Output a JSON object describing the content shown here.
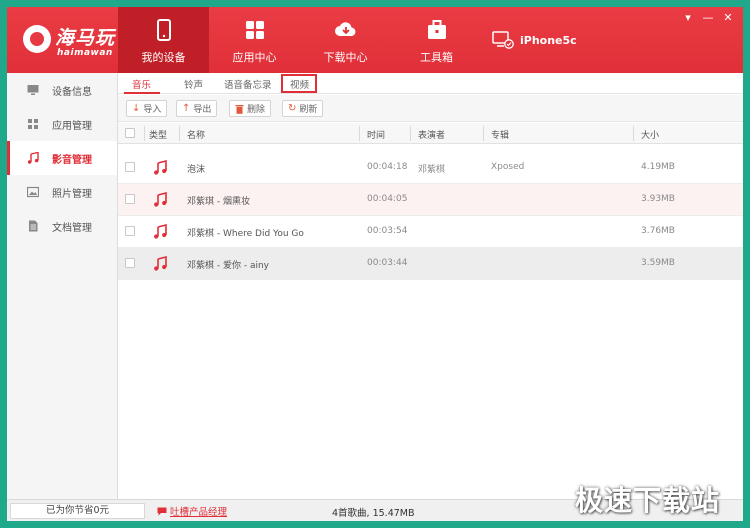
{
  "app": {
    "logo_cn": "海马玩",
    "logo_en": "haimawan"
  },
  "nav": [
    {
      "label": "我的设备",
      "icon": "phone-icon",
      "active": true
    },
    {
      "label": "应用中心",
      "icon": "grid-icon"
    },
    {
      "label": "下载中心",
      "icon": "cloud-download-icon"
    },
    {
      "label": "工具箱",
      "icon": "toolbox-icon"
    }
  ],
  "device": {
    "name": "iPhone5c"
  },
  "sidebar": {
    "items": [
      {
        "label": "设备信息",
        "icon": "monitor-icon"
      },
      {
        "label": "应用管理",
        "icon": "apps-icon"
      },
      {
        "label": "影音管理",
        "icon": "music-note-icon",
        "active": true
      },
      {
        "label": "照片管理",
        "icon": "photo-icon"
      },
      {
        "label": "文档管理",
        "icon": "document-icon"
      }
    ]
  },
  "subtabs": [
    {
      "label": "音乐",
      "active": true
    },
    {
      "label": "铃声"
    },
    {
      "label": "语音备忘录"
    },
    {
      "label": "视频"
    }
  ],
  "toolbar": {
    "import_label": "导入",
    "export_label": "导出",
    "delete_label": "删除",
    "refresh_label": "刷新"
  },
  "table": {
    "headers": {
      "type": "类型",
      "name": "名称",
      "time": "时间",
      "artist": "表演者",
      "album": "专辑",
      "size": "大小"
    },
    "rows": [
      {
        "name": "泡沫",
        "time": "00:04:18",
        "artist": "邓紫棋",
        "album": "Xposed",
        "size": "4.19MB"
      },
      {
        "name": "邓紫琪 - 烟熏妆",
        "time": "00:04:05",
        "artist": "",
        "album": "",
        "size": "3.93MB"
      },
      {
        "name": "邓紫棋 - Where Did You Go",
        "time": "00:03:54",
        "artist": "",
        "album": "",
        "size": "3.76MB"
      },
      {
        "name": "邓紫棋 - 爱你 - ainy",
        "time": "00:03:44",
        "artist": "",
        "album": "",
        "size": "3.59MB"
      }
    ]
  },
  "status": {
    "savings": "已为你节省0元",
    "feedback": "吐槽产品经理",
    "summary": "4首歌曲, 15.47MB"
  },
  "watermark": "极速下载站",
  "colors": {
    "accent": "#e02f38",
    "frame": "#1fa98a",
    "nav_active": "#c01f28"
  }
}
